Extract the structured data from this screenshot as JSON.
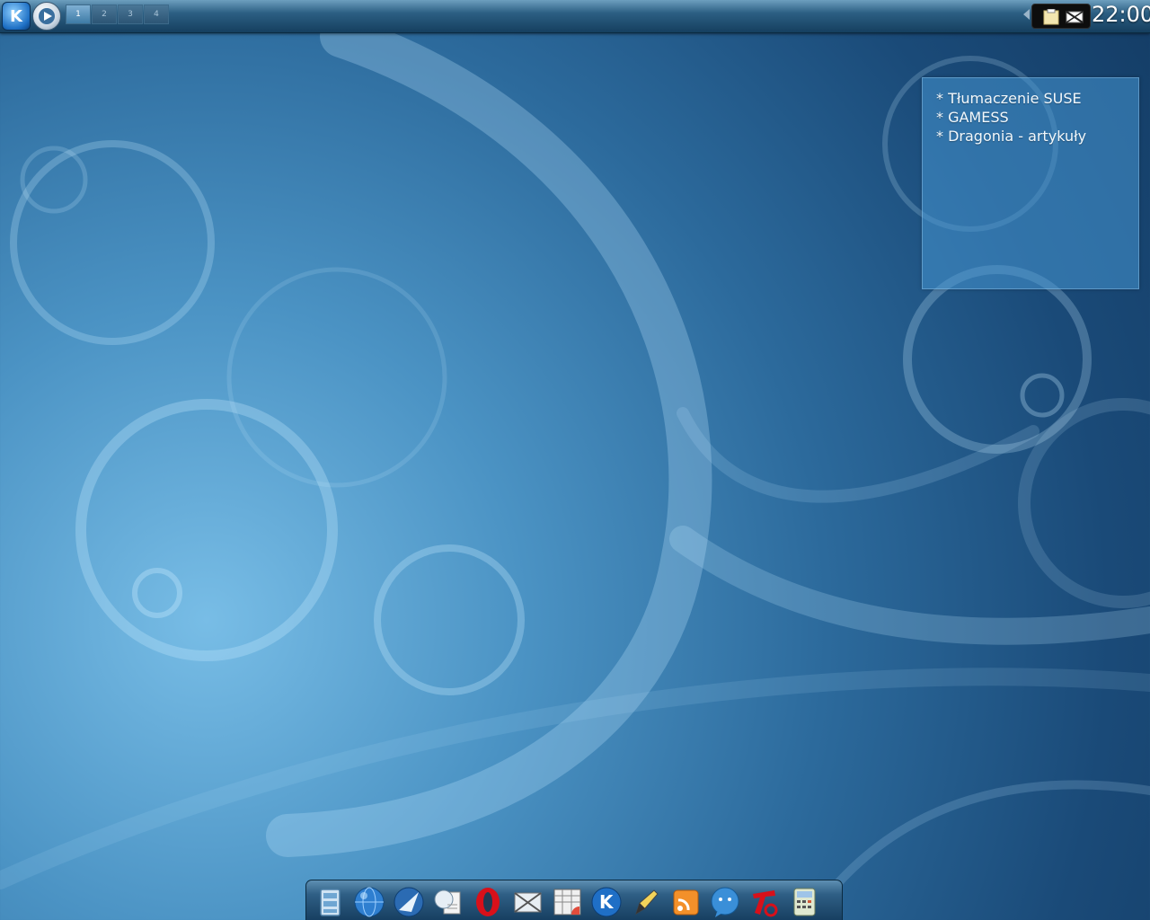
{
  "desktop": {
    "accent_color": "#2c6a9c",
    "wallpaper": "blue-swirls"
  },
  "top_panel": {
    "kmenu_icon": "kde-menu-icon",
    "kmenu_glyph": "K",
    "media_icon": "play-icon",
    "pager": {
      "desktops": [
        "1",
        "2",
        "3",
        "4"
      ],
      "active_index": 0
    },
    "systray": {
      "icons": [
        "clipboard-icon",
        "network-off-icon"
      ]
    },
    "clock": "22:00"
  },
  "note_widget": {
    "items": [
      "* Tłumaczenie SUSE",
      "* GAMESS",
      "* Dragonia - artykuły"
    ]
  },
  "dock": {
    "icons": [
      "file-manager-icon",
      "web-browser-icon",
      "email-client-icon",
      "documents-icon",
      "opera-icon",
      "image-viewer-icon",
      "spreadsheet-icon",
      "kde-search-icon",
      "text-editor-icon",
      "rss-reader-icon",
      "chat-icon",
      "tools-icon",
      "calculator-icon"
    ]
  }
}
